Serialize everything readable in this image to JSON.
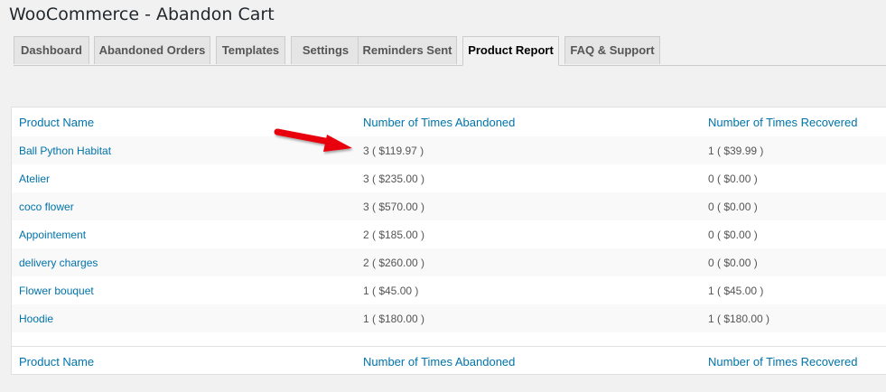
{
  "page_title": "WooCommerce - Abandon Cart",
  "tabs": [
    {
      "label": "Dashboard",
      "active": false
    },
    {
      "label": "Abandoned Orders",
      "active": false
    },
    {
      "label": "Templates",
      "active": false
    },
    {
      "label": "Settings",
      "active": false
    },
    {
      "label": "Reminders Sent",
      "active": false
    },
    {
      "label": "Product Report",
      "active": true
    },
    {
      "label": "FAQ & Support",
      "active": false
    }
  ],
  "table": {
    "columns": [
      "Product Name",
      "Number of Times Abandoned",
      "Number of Times Recovered"
    ],
    "rows": [
      {
        "product": "Ball Python Habitat",
        "abandoned": "3 ( $119.97 )",
        "recovered": "1 ( $39.99 )"
      },
      {
        "product": "Atelier",
        "abandoned": "3 ( $235.00 )",
        "recovered": "0 ( $0.00 )"
      },
      {
        "product": "coco flower",
        "abandoned": "3 ( $570.00 )",
        "recovered": "0 ( $0.00 )"
      },
      {
        "product": "Appointement",
        "abandoned": "2 ( $185.00 )",
        "recovered": "0 ( $0.00 )"
      },
      {
        "product": "delivery charges",
        "abandoned": "2 ( $260.00 )",
        "recovered": "0 ( $0.00 )"
      },
      {
        "product": "Flower bouquet",
        "abandoned": "1 ( $45.00 )",
        "recovered": "1 ( $45.00 )"
      },
      {
        "product": "Hoodie",
        "abandoned": "1 ( $180.00 )",
        "recovered": "1 ( $180.00 )"
      }
    ]
  },
  "annotation": {
    "icon": "red-arrow-icon",
    "color": "#e8000b"
  }
}
